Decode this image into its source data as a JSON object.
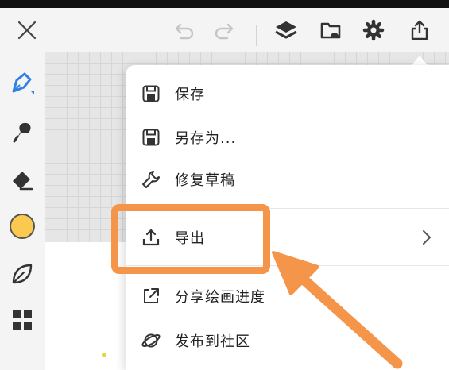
{
  "menu": {
    "items": [
      {
        "id": "save",
        "label": "保存",
        "icon": "save-icon"
      },
      {
        "id": "save-as",
        "label": "另存为...",
        "icon": "save-as-icon"
      },
      {
        "id": "repair",
        "label": "修复草稿",
        "icon": "wrench-icon"
      },
      {
        "id": "export",
        "label": "导出",
        "icon": "export-icon",
        "has_submenu": true
      },
      {
        "id": "share",
        "label": "分享绘画进度",
        "icon": "share-icon"
      },
      {
        "id": "publish",
        "label": "发布到社区",
        "icon": "planet-icon"
      }
    ]
  },
  "toolbar": {
    "icons": [
      "close-icon",
      "undo-icon",
      "redo-icon",
      "layers-icon",
      "folder-icon",
      "gear-icon",
      "share-upload-icon"
    ]
  },
  "sidebar": {
    "tools": [
      "pen-icon",
      "smudge-icon",
      "eraser-icon",
      "color-swatch",
      "leaf-icon",
      "grid-icon"
    ],
    "current_color": "#fbc950"
  },
  "colors": {
    "accent": "#2f7fe6",
    "annotation": "#f4954a"
  }
}
